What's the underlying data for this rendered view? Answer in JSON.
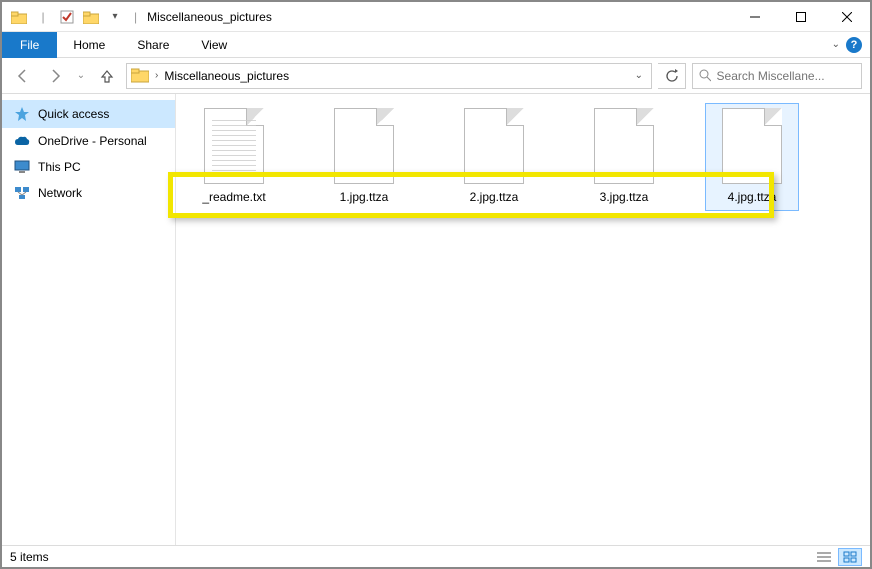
{
  "window": {
    "title": "Miscellaneous_pictures"
  },
  "ribbon": {
    "file_tab": "File",
    "tabs": [
      "Home",
      "Share",
      "View"
    ]
  },
  "address": {
    "path": "Miscellaneous_pictures"
  },
  "search": {
    "placeholder": "Search Miscellane..."
  },
  "sidebar": {
    "items": [
      {
        "label": "Quick access",
        "selected": true,
        "icon": "star"
      },
      {
        "label": "OneDrive - Personal",
        "selected": false,
        "icon": "cloud"
      },
      {
        "label": "This PC",
        "selected": false,
        "icon": "pc"
      },
      {
        "label": "Network",
        "selected": false,
        "icon": "network"
      }
    ]
  },
  "files": [
    {
      "name": "_readme.txt",
      "textfile": true,
      "selected": false
    },
    {
      "name": "1.jpg.ttza",
      "textfile": false,
      "selected": false
    },
    {
      "name": "2.jpg.ttza",
      "textfile": false,
      "selected": false
    },
    {
      "name": "3.jpg.ttza",
      "textfile": false,
      "selected": false
    },
    {
      "name": "4.jpg.ttza",
      "textfile": false,
      "selected": true
    }
  ],
  "status": {
    "item_count": "5 items"
  }
}
